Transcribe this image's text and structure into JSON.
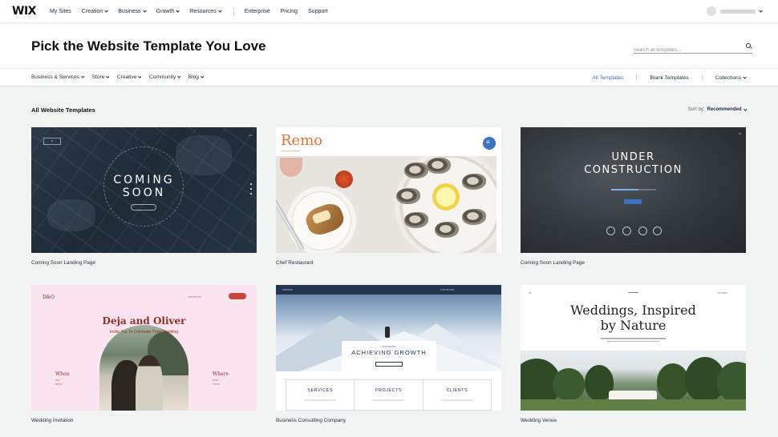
{
  "topbar": {
    "logo": "WIX",
    "nav": [
      {
        "label": "My Sites",
        "dropdown": false
      },
      {
        "label": "Creation",
        "dropdown": true
      },
      {
        "label": "Business",
        "dropdown": true
      },
      {
        "label": "Growth",
        "dropdown": true
      },
      {
        "label": "Resources",
        "dropdown": true
      }
    ],
    "nav_right": [
      "Enterprise",
      "Pricing",
      "Support"
    ]
  },
  "header": {
    "title": "Pick the Website Template You Love",
    "search_placeholder": "Search all templates..."
  },
  "categories": [
    "Business & Services",
    "Store",
    "Creative",
    "Community",
    "Blog"
  ],
  "filters": {
    "all": "All Templates",
    "blank": "Blank Templates",
    "collections": "Collections"
  },
  "section": {
    "title": "All Website Templates",
    "sort_prefix": "Sort by:",
    "sort_value": "Recommended"
  },
  "templates": [
    {
      "name": "Coming Soon Landing Page",
      "preview": {
        "heading_1": "COMING",
        "heading_2": "SOON"
      }
    },
    {
      "name": "Chef Restaurant",
      "preview": {
        "brand": "Remo"
      }
    },
    {
      "name": "Coming Soon Landing Page",
      "preview": {
        "heading_1": "UNDER",
        "heading_2": "CONSTRUCTION"
      }
    },
    {
      "name": "Wedding Invitation",
      "preview": {
        "names": "Deja and Oliver",
        "invite": "Invite You To Celebrate Their Wedding",
        "when": "When",
        "where": "Where"
      }
    },
    {
      "name": "Business Consulting Company",
      "preview": {
        "heading": "ACHIEVING GROWTH",
        "columns": [
          "SERVICES",
          "PROJECTS",
          "CLIENTS"
        ]
      }
    },
    {
      "name": "Wedding Venue",
      "preview": {
        "title_1": "Weddings, Inspired",
        "title_2": "by Nature"
      }
    }
  ],
  "colors": {
    "accent": "#3b6fd6",
    "chef_orange": "#e3732f",
    "wedding_red": "#8f2f26"
  }
}
